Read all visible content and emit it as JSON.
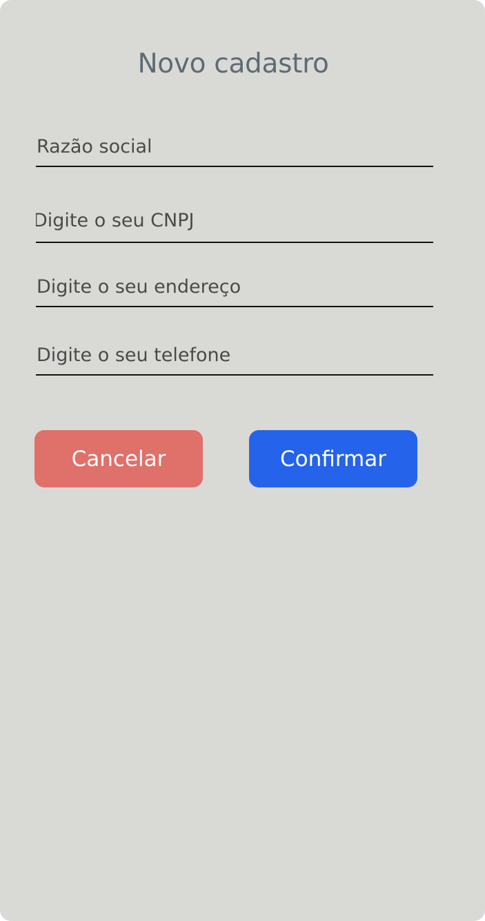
{
  "header": {
    "title": "Novo cadastro"
  },
  "form": {
    "fields": [
      {
        "placeholder": "Razão social",
        "value": ""
      },
      {
        "placeholder": "Digite o seu CNPJ",
        "value": ""
      },
      {
        "placeholder": "Digite o seu endereço",
        "value": ""
      },
      {
        "placeholder": "Digite o seu telefone",
        "value": ""
      }
    ]
  },
  "actions": {
    "cancel_label": "Cancelar",
    "confirm_label": "Confirmar"
  },
  "colors": {
    "background": "#d9dad6",
    "title": "#5f6b74",
    "cancel": "#e0706a",
    "confirm": "#2563eb"
  }
}
